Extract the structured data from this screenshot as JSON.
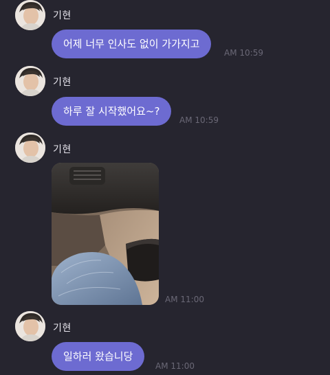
{
  "messages": [
    {
      "sender": "기현",
      "text": "어제 너무 인사도 없이 가가지고",
      "time": "AM 10:59"
    },
    {
      "sender": "기현",
      "text": "하루 잘 시작했어요~?",
      "time": "AM 10:59"
    },
    {
      "sender": "기현",
      "photo": "car-interior-photo",
      "time": "AM 11:00"
    },
    {
      "sender": "기현",
      "text": "일하러 왔습니당",
      "time": "AM 11:00"
    }
  ],
  "colors": {
    "background": "#26252f",
    "bubble": "#6d6bd1",
    "timestamp": "#6a6876",
    "sender": "#e8e6ee"
  },
  "icons": {
    "avatar": "profile-avatar"
  }
}
